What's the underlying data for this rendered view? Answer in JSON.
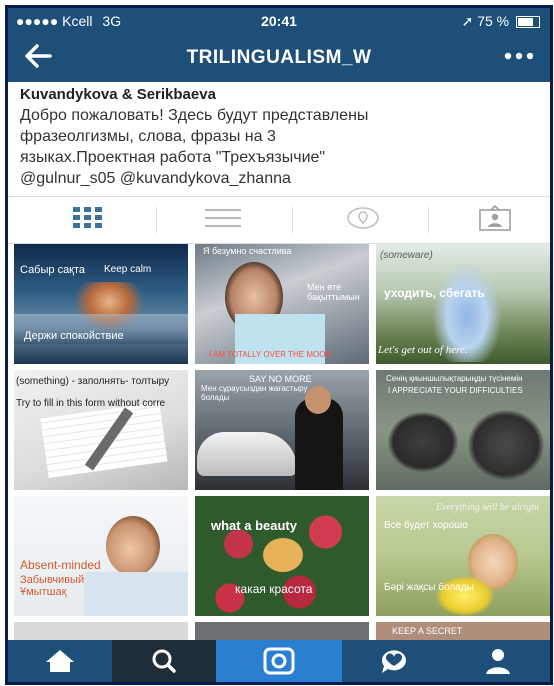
{
  "status": {
    "carrier": "Kcell",
    "network": "3G",
    "time": "20:41",
    "battery_text": "75 %",
    "battery_level": 0.75
  },
  "nav": {
    "title": "TRILINGUALISM_W"
  },
  "profile": {
    "name": "Kuvandykova & Serikbaeva",
    "bio_line1": "Добро пожаловать! Здесь будут представлены",
    "bio_line2": "фразеолгизмы, слова, фразы на 3",
    "bio_line3": "языках.Проектная работа \"Трехъязычие\"",
    "mentions": "@gulnur_s05 @kuvandykova_zhanna"
  },
  "posts": [
    {
      "top": "Сабыр сақта",
      "mid": "Keep calm",
      "bottom": "Держи спокойствие"
    },
    {
      "top": "Я безумно счастлива",
      "mid": "Мен өте бақыттымын",
      "bottom": "I AM TOTALLY OVER THE MOON"
    },
    {
      "top": "(someware)",
      "mid": "уходить, сбегать",
      "bottom": "Let's get out of here."
    },
    {
      "top": "(something) - заполнять- толтыру",
      "mid": "",
      "bottom": "Try to fill in this form without corre"
    },
    {
      "top": "SAY NO MORE",
      "mid": "Мен сұраусыздан жағастыру болады",
      "bottom": ""
    },
    {
      "top": "Сенің қиыншылықтарыңды түсінемін",
      "mid": "I APPRECIATE YOUR DIFFICULTIES",
      "bottom": ""
    },
    {
      "top": "",
      "mid": "Absent-minded",
      "bottom": "Забывчивый Ұмытшақ"
    },
    {
      "top": "what a beauty",
      "mid": "",
      "bottom": "какая красота"
    },
    {
      "top": "Everything will be alright",
      "mid": "Все будет хорошо",
      "bottom": "Бәрі жақсы болады"
    },
    {
      "top": "",
      "mid": "",
      "bottom": ""
    },
    {
      "top": "",
      "mid": "",
      "bottom": ""
    },
    {
      "top": "KEEP A SECRET",
      "mid": "",
      "bottom": ""
    }
  ],
  "colors": {
    "header": "#1e4f78",
    "accent": "#3f729b",
    "tab_bar": "#1e4f78",
    "tab_active": "#2a7fd1"
  },
  "icons": {
    "back": "arrow-left-icon",
    "more": "more-dots-icon"
  }
}
